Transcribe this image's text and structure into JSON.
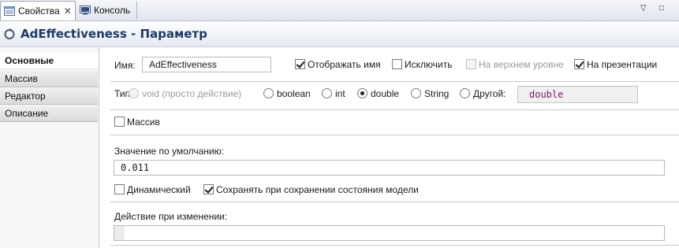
{
  "tabs": [
    {
      "label": "Свойства",
      "close": "✕"
    },
    {
      "label": "Консоль"
    }
  ],
  "window_controls": {
    "minimize": "▽",
    "restore": "□"
  },
  "header": {
    "title": "AdEffectiveness - Параметр"
  },
  "sidebar": {
    "items": [
      {
        "label": "Основные",
        "active": true
      },
      {
        "label": "Массив"
      },
      {
        "label": "Редактор"
      },
      {
        "label": "Описание"
      }
    ]
  },
  "main": {
    "name_label": "Имя:",
    "name_value": "AdEffectiveness",
    "show_name": {
      "label": "Отображать имя",
      "checked": true
    },
    "exclude": {
      "label": "Исключить",
      "checked": false
    },
    "top_level": {
      "label": "На верхнем уровне",
      "checked": false,
      "disabled": true
    },
    "on_presentation": {
      "label": "На презентации",
      "checked": true
    },
    "type_label": "Тип:",
    "type_options": [
      {
        "label": "void (просто действие)",
        "disabled": true
      },
      {
        "label": "boolean"
      },
      {
        "label": "int"
      },
      {
        "label": "double",
        "selected": true
      },
      {
        "label": "String"
      },
      {
        "label": "Другой:"
      }
    ],
    "other_type_value": "double",
    "array": {
      "label": "Массив",
      "checked": false
    },
    "default_value_label": "Значение по умолчанию:",
    "default_value": "0.011",
    "dynamic": {
      "label": "Динамический",
      "checked": false
    },
    "save_state": {
      "label": "Сохранять при сохранении состояния модели",
      "checked": true
    },
    "on_change_label": "Действие при изменении:",
    "on_change_value": ""
  },
  "colors": {
    "title": "#1e3a66",
    "type_keyword": "#7a1a6e"
  }
}
